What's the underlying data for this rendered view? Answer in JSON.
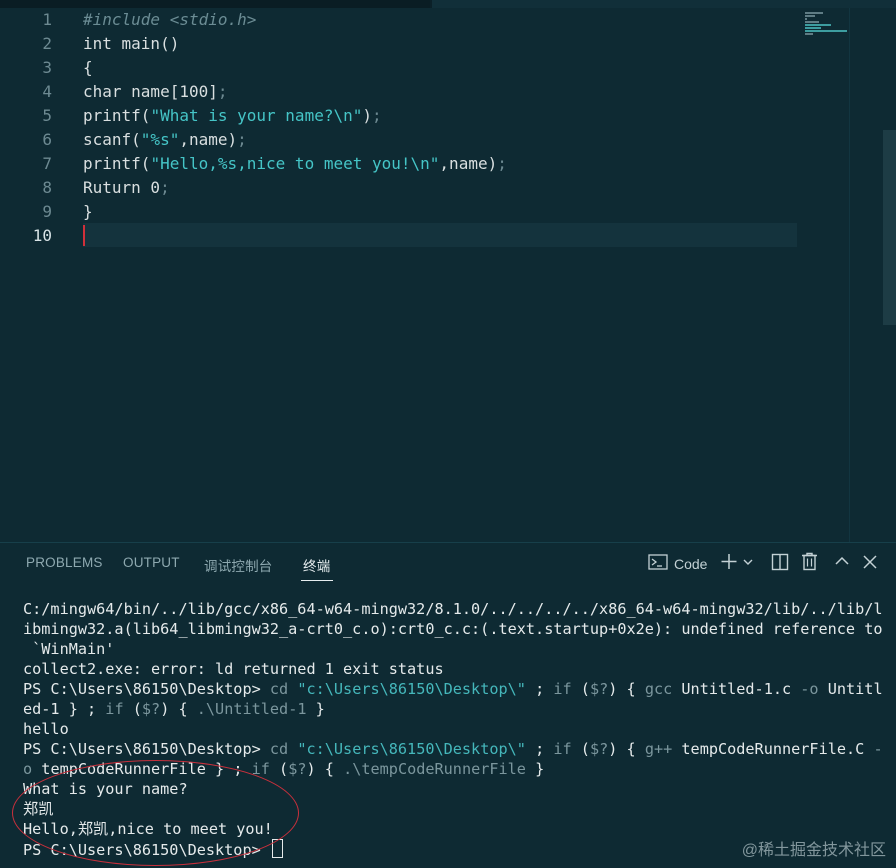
{
  "editor": {
    "lines": [
      {
        "num": "1",
        "parts": [
          {
            "t": "#include <stdio.h>",
            "c": "comment"
          }
        ]
      },
      {
        "num": "2",
        "parts": [
          {
            "t": "int main()",
            "c": ""
          }
        ]
      },
      {
        "num": "3",
        "parts": [
          {
            "t": "{",
            "c": ""
          }
        ]
      },
      {
        "num": "4",
        "parts": [
          {
            "t": "char name[100]",
            "c": ""
          },
          {
            "t": ";",
            "c": "punct"
          }
        ]
      },
      {
        "num": "5",
        "parts": [
          {
            "t": "printf(",
            "c": ""
          },
          {
            "t": "\"What is your name?\\n\"",
            "c": "str"
          },
          {
            "t": ")",
            "c": ""
          },
          {
            "t": ";",
            "c": "punct"
          }
        ]
      },
      {
        "num": "6",
        "parts": [
          {
            "t": "scanf(",
            "c": ""
          },
          {
            "t": "\"%s\"",
            "c": "str"
          },
          {
            "t": ",name)",
            "c": ""
          },
          {
            "t": ";",
            "c": "punct"
          }
        ]
      },
      {
        "num": "7",
        "parts": [
          {
            "t": "printf(",
            "c": ""
          },
          {
            "t": "\"Hello,%s,nice to meet you!\\n\"",
            "c": "str"
          },
          {
            "t": ",name)",
            "c": ""
          },
          {
            "t": ";",
            "c": "punct"
          }
        ]
      },
      {
        "num": "8",
        "parts": [
          {
            "t": "Ruturn 0",
            "c": ""
          },
          {
            "t": ";",
            "c": "punct"
          }
        ]
      },
      {
        "num": "9",
        "parts": [
          {
            "t": "}",
            "c": ""
          }
        ]
      },
      {
        "num": "10",
        "parts": []
      }
    ]
  },
  "panel": {
    "tabs": [
      {
        "label": "PROBLEMS"
      },
      {
        "label": "OUTPUT"
      },
      {
        "label": "调试控制台"
      },
      {
        "label": "终端"
      }
    ],
    "active_tab": "终端",
    "terminal_selector": "Code",
    "icons": [
      "terminal-icon",
      "plus-icon",
      "chevron-down-icon",
      "split-icon",
      "trash-icon",
      "chevron-up-icon",
      "close-icon"
    ]
  },
  "terminal": {
    "lines": [
      [
        {
          "t": "C:/mingw64/bin/../lib/gcc/x86_64-w64-mingw32/8.1.0/../../../../x86_64-w64-mingw32/lib/../lib/l",
          "c": ""
        }
      ],
      [
        {
          "t": "ibmingw32.a(lib64_libmingw32_a-crt0_c.o):crt0_c.c:(.text.startup+0x2e): undefined reference to",
          "c": ""
        }
      ],
      [
        {
          "t": " `WinMain'",
          "c": ""
        }
      ],
      [
        {
          "t": "collect2.exe: error: ld returned 1 exit status",
          "c": ""
        }
      ],
      [
        {
          "t": "PS C:\\Users\\86150\\Desktop> ",
          "c": ""
        },
        {
          "t": "cd ",
          "c": "dim"
        },
        {
          "t": "\"c:\\Users\\86150\\Desktop\\\"",
          "c": "arg"
        },
        {
          "t": " ; ",
          "c": ""
        },
        {
          "t": "if",
          "c": "dim"
        },
        {
          "t": " (",
          "c": ""
        },
        {
          "t": "$?",
          "c": "dim"
        },
        {
          "t": ") { ",
          "c": ""
        },
        {
          "t": "gcc",
          "c": "dim"
        },
        {
          "t": " Untitled-1.c ",
          "c": ""
        },
        {
          "t": "-o",
          "c": "dim"
        },
        {
          "t": " Untitl",
          "c": ""
        }
      ],
      [
        {
          "t": "ed-1 } ; ",
          "c": ""
        },
        {
          "t": "if",
          "c": "dim"
        },
        {
          "t": " (",
          "c": ""
        },
        {
          "t": "$?",
          "c": "dim"
        },
        {
          "t": ") { ",
          "c": ""
        },
        {
          "t": ".\\Untitled-1",
          "c": "dim"
        },
        {
          "t": " }",
          "c": ""
        }
      ],
      [
        {
          "t": "hello",
          "c": ""
        }
      ],
      [
        {
          "t": "PS C:\\Users\\86150\\Desktop> ",
          "c": ""
        },
        {
          "t": "cd ",
          "c": "dim"
        },
        {
          "t": "\"c:\\Users\\86150\\Desktop\\\"",
          "c": "arg"
        },
        {
          "t": " ; ",
          "c": ""
        },
        {
          "t": "if",
          "c": "dim"
        },
        {
          "t": " (",
          "c": ""
        },
        {
          "t": "$?",
          "c": "dim"
        },
        {
          "t": ") { ",
          "c": ""
        },
        {
          "t": "g++",
          "c": "dim"
        },
        {
          "t": " tempCodeRunnerFile.C ",
          "c": ""
        },
        {
          "t": "-",
          "c": "dim"
        }
      ],
      [
        {
          "t": "o",
          "c": "dim"
        },
        {
          "t": " tempCodeRunnerFile } ; ",
          "c": ""
        },
        {
          "t": "if",
          "c": "dim"
        },
        {
          "t": " (",
          "c": ""
        },
        {
          "t": "$?",
          "c": "dim"
        },
        {
          "t": ") { ",
          "c": ""
        },
        {
          "t": ".\\tempCodeRunnerFile",
          "c": "dim"
        },
        {
          "t": " }",
          "c": ""
        }
      ],
      [
        {
          "t": "What is your name?",
          "c": ""
        }
      ],
      [
        {
          "t": "郑凯",
          "c": ""
        }
      ],
      [
        {
          "t": "Hello,郑凯,nice to meet you!",
          "c": ""
        }
      ],
      [
        {
          "t": "PS C:\\Users\\86150\\Desktop> ",
          "c": ""
        }
      ]
    ]
  },
  "watermark": "@稀土掘金技术社区"
}
